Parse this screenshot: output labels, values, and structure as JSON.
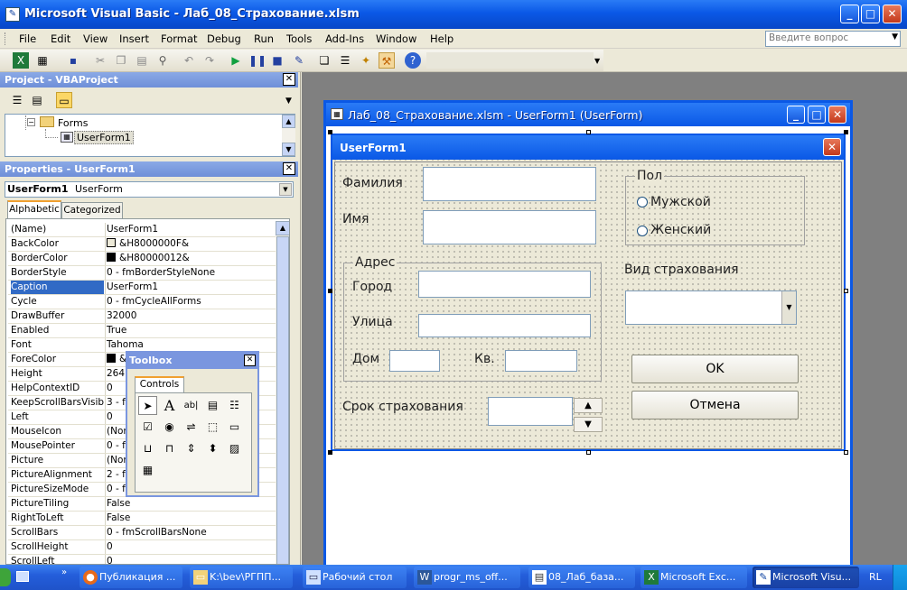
{
  "app": {
    "title": "Microsoft Visual Basic - Лаб_08_Страхование.xlsm"
  },
  "menu": {
    "items": [
      "File",
      "Edit",
      "View",
      "Insert",
      "Format",
      "Debug",
      "Run",
      "Tools",
      "Add-Ins",
      "Window",
      "Help"
    ]
  },
  "help_box": {
    "placeholder": "Введите вопрос"
  },
  "project": {
    "title": "Project - VBAProject",
    "tree": {
      "folder": "Forms",
      "item": "UserForm1"
    }
  },
  "properties": {
    "title": "Properties - UserForm1",
    "object_name": "UserForm1",
    "object_type": "UserForm",
    "tabs": [
      "Alphabetic",
      "Categorized"
    ],
    "rows": [
      {
        "name": "(Name)",
        "value": "UserForm1"
      },
      {
        "name": "BackColor",
        "value": "&H8000000F&",
        "swatch": "#ece9d8"
      },
      {
        "name": "BorderColor",
        "value": "&H80000012&",
        "swatch": "#000000"
      },
      {
        "name": "BorderStyle",
        "value": "0 - fmBorderStyleNone"
      },
      {
        "name": "Caption",
        "value": "UserForm1",
        "selected": true
      },
      {
        "name": "Cycle",
        "value": "0 - fmCycleAllForms"
      },
      {
        "name": "DrawBuffer",
        "value": "32000"
      },
      {
        "name": "Enabled",
        "value": "True"
      },
      {
        "name": "Font",
        "value": "Tahoma"
      },
      {
        "name": "ForeColor",
        "value": "&",
        "swatch": "#000000"
      },
      {
        "name": "Height",
        "value": "264"
      },
      {
        "name": "HelpContextID",
        "value": "0"
      },
      {
        "name": "KeepScrollBarsVisible",
        "value": "3 - fr"
      },
      {
        "name": "Left",
        "value": "0"
      },
      {
        "name": "MouseIcon",
        "value": "(Non"
      },
      {
        "name": "MousePointer",
        "value": "0 - fr"
      },
      {
        "name": "Picture",
        "value": "(Non"
      },
      {
        "name": "PictureAlignment",
        "value": "2 - fr"
      },
      {
        "name": "PictureSizeMode",
        "value": "0 - fr"
      },
      {
        "name": "PictureTiling",
        "value": "False"
      },
      {
        "name": "RightToLeft",
        "value": "False"
      },
      {
        "name": "ScrollBars",
        "value": "0 - fmScrollBarsNone"
      },
      {
        "name": "ScrollHeight",
        "value": "0"
      },
      {
        "name": "ScrollLeft",
        "value": "0"
      }
    ]
  },
  "toolbox": {
    "title": "Toolbox",
    "tab": "Controls",
    "tools": [
      "pointer-icon",
      "label-icon",
      "textbox-icon",
      "combobox-icon",
      "listbox-icon",
      "checkbox-icon",
      "optionbutton-icon",
      "togglebutton-icon",
      "frame-icon",
      "commandbutton-icon",
      "tabstrip-icon",
      "multipage-icon",
      "scrollbar-icon",
      "spinbutton-icon",
      "image-icon",
      "refedit-icon"
    ]
  },
  "designer": {
    "title": "Лаб_08_Страхование.xlsm - UserForm1 (UserForm)"
  },
  "userform": {
    "title": "UserForm1",
    "lbl_surname": "Фамилия",
    "lbl_name": "Имя",
    "gender": {
      "legend": "Пол",
      "male": "Мужской",
      "female": "Женский"
    },
    "address": {
      "legend": "Адрес",
      "city": "Город",
      "street": "Улица",
      "house": "Дом",
      "apt": "Кв."
    },
    "lbl_insurance_type": "Вид страхования",
    "lbl_term": "Срок страхования",
    "ok": "OK",
    "cancel": "Отмена"
  },
  "taskbar": {
    "items": [
      {
        "label": "Публикация ...",
        "icon": "firefox-icon"
      },
      {
        "label": "K:\\bev\\РГПП...",
        "icon": "folder-icon"
      },
      {
        "label": "Рабочий стол",
        "icon": "desktop-icon"
      },
      {
        "label": "progr_ms_off...",
        "icon": "word-icon"
      },
      {
        "label": "08_Лаб_база...",
        "icon": "document-icon"
      },
      {
        "label": "Microsoft Exc...",
        "icon": "excel-icon"
      },
      {
        "label": "Microsoft Visu...",
        "icon": "vb-icon",
        "active": true
      }
    ],
    "lang": "RL"
  },
  "colors": {
    "xp_blue": "#0a58e6",
    "selection": "#316ac5",
    "panel_title": "#7a96df"
  }
}
